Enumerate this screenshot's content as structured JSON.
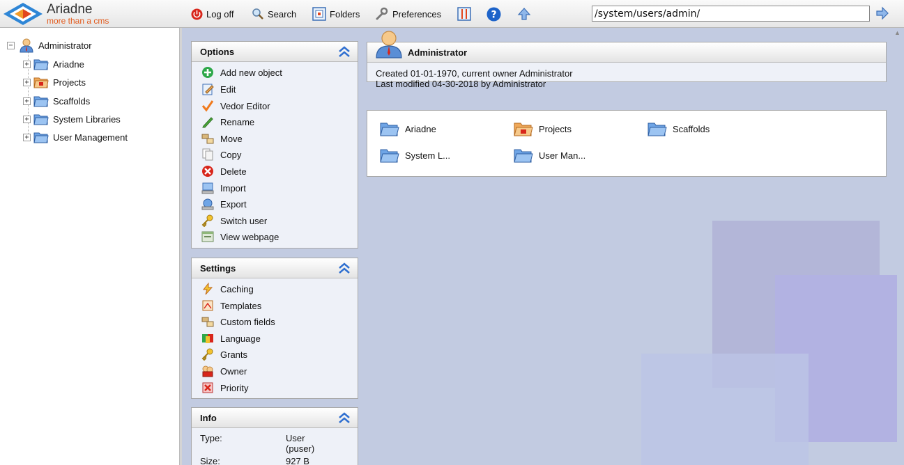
{
  "app": {
    "name": "Ariadne",
    "tagline": "more than a cms"
  },
  "toolbar": {
    "logoff": "Log off",
    "search": "Search",
    "folders": "Folders",
    "preferences": "Preferences"
  },
  "address": {
    "value": "/system/users/admin/"
  },
  "tree": {
    "root": "Administrator",
    "items": [
      "Ariadne",
      "Projects",
      "Scaffolds",
      "System Libraries",
      "User Management"
    ]
  },
  "options": {
    "title": "Options",
    "items": [
      "Add new object",
      "Edit",
      "Vedor Editor",
      "Rename",
      "Move",
      "Copy",
      "Delete",
      "Import",
      "Export",
      "Switch user",
      "View webpage"
    ]
  },
  "settings": {
    "title": "Settings",
    "items": [
      "Caching",
      "Templates",
      "Custom fields",
      "Language",
      "Grants",
      "Owner",
      "Priority"
    ]
  },
  "info": {
    "title": "Info",
    "type_label": "Type:",
    "type_value": "User",
    "type_sub": "(puser)",
    "size_label": "Size:",
    "size_value": "927 B"
  },
  "object": {
    "title": "Administrator",
    "created": "Created 01-01-1970, current owner Administrator",
    "modified": "Last modified 04-30-2018 by Administrator"
  },
  "children": [
    "Ariadne",
    "Projects",
    "Scaffolds",
    "System L...",
    "User Man..."
  ]
}
